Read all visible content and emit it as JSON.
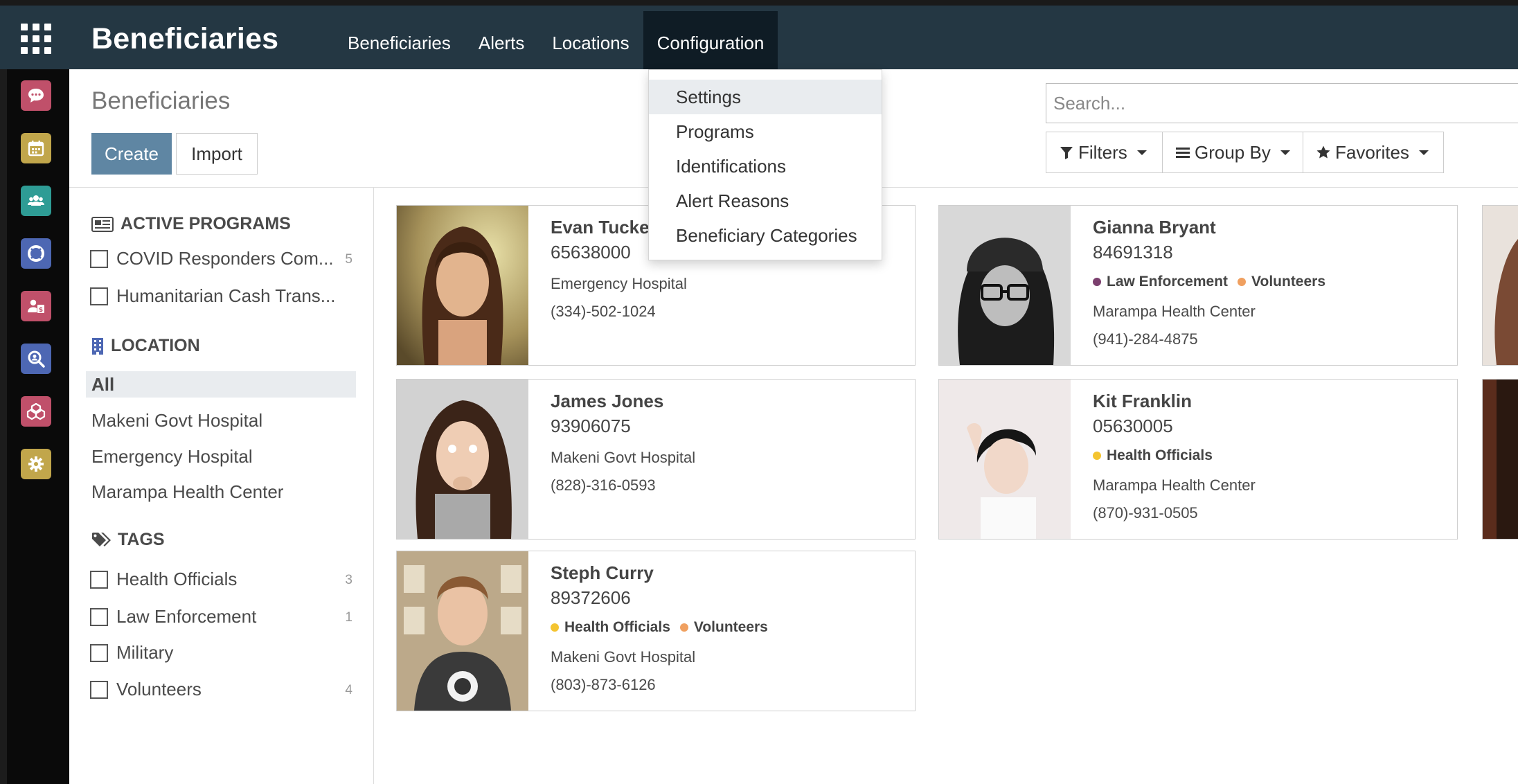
{
  "header": {
    "brand": "Beneficiaries",
    "menu": [
      "Beneficiaries",
      "Alerts",
      "Locations",
      "Configuration"
    ],
    "active_menu": "Configuration"
  },
  "config_menu": [
    "Settings",
    "Programs",
    "Identifications",
    "Alert Reasons",
    "Beneficiary Categories"
  ],
  "control_panel": {
    "title": "Beneficiaries",
    "create_label": "Create",
    "import_label": "Import",
    "search_placeholder": "Search...",
    "filters_label": "Filters",
    "groupby_label": "Group By",
    "favorites_label": "Favorites"
  },
  "search_panel": {
    "programs_heading": "ACTIVE PROGRAMS",
    "programs": [
      {
        "label": "COVID Responders Com...",
        "count": "5"
      },
      {
        "label": "Humanitarian Cash Trans...",
        "count": ""
      }
    ],
    "location_heading": "LOCATION",
    "locations": [
      "All",
      "Makeni Govt Hospital",
      "Emergency Hospital",
      "Marampa Health Center"
    ],
    "tags_heading": "TAGS",
    "tags": [
      {
        "label": "Health Officials",
        "count": "3"
      },
      {
        "label": "Law Enforcement",
        "count": "1"
      },
      {
        "label": "Military",
        "count": ""
      },
      {
        "label": "Volunteers",
        "count": "4"
      }
    ]
  },
  "cards": [
    {
      "name": "Evan Tucker",
      "id": "65638000",
      "tags": [],
      "location": "Emergency Hospital",
      "phone": "(334)-502-1024"
    },
    {
      "name": "Gianna Bryant",
      "id": "84691318",
      "tags": [
        {
          "label": "Law Enforcement",
          "color": "#7b3f6e"
        },
        {
          "label": "Volunteers",
          "color": "#f0a060"
        }
      ],
      "location": "Marampa Health Center",
      "phone": "(941)-284-4875"
    },
    {
      "name": "James Jones",
      "id": "93906075",
      "tags": [],
      "location": "Makeni Govt Hospital",
      "phone": "(828)-316-0593"
    },
    {
      "name": "Kit Franklin",
      "id": "05630005",
      "tags": [
        {
          "label": "Health Officials",
          "color": "#f4c430"
        }
      ],
      "location": "Marampa Health Center",
      "phone": "(870)-931-0505"
    },
    {
      "name": "Steph Curry",
      "id": "89372606",
      "tags": [
        {
          "label": "Health Officials",
          "color": "#f4c430"
        },
        {
          "label": "Volunteers",
          "color": "#f0a060"
        }
      ],
      "location": "Makeni Govt Hospital",
      "phone": "(803)-873-6126"
    }
  ],
  "colors": {
    "navbar": "#243743",
    "primary": "#5f86a3",
    "app_icons": [
      "#c0506a",
      "#c1a64b",
      "#2e9c95",
      "#4d67b3",
      "#c0506a",
      "#4d67b3",
      "#c0506a",
      "#c1a64b"
    ]
  },
  "app_icon_names": [
    "discuss-icon",
    "calendar-icon",
    "contacts-icon",
    "helpdesk-icon",
    "payroll-icon",
    "search-app-icon",
    "inventory-icon",
    "settings-icon"
  ]
}
